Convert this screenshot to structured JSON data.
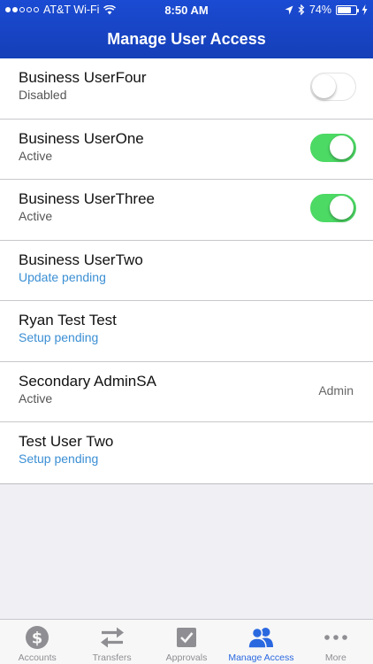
{
  "status_bar": {
    "carrier": "AT&T Wi-Fi",
    "time": "8:50 AM",
    "battery": "74%",
    "battery_level": 0.74
  },
  "nav": {
    "title": "Manage User Access"
  },
  "users": [
    {
      "name": "Business UserFour",
      "status": "Disabled",
      "status_color": "#555555",
      "toggle": "off",
      "tag": ""
    },
    {
      "name": "Business UserOne",
      "status": "Active",
      "status_color": "#555555",
      "toggle": "on",
      "tag": ""
    },
    {
      "name": "Business UserThree",
      "status": "Active",
      "status_color": "#555555",
      "toggle": "on",
      "tag": ""
    },
    {
      "name": "Business UserTwo",
      "status": "Update pending",
      "status_color": "#3b8fd4",
      "toggle": "none",
      "tag": ""
    },
    {
      "name": "Ryan Test Test",
      "status": "Setup pending",
      "status_color": "#3b8fd4",
      "toggle": "none",
      "tag": ""
    },
    {
      "name": "Secondary AdminSA",
      "status": "Active",
      "status_color": "#555555",
      "toggle": "none",
      "tag": "Admin"
    },
    {
      "name": "Test User Two",
      "status": "Setup pending",
      "status_color": "#3b8fd4",
      "toggle": "none",
      "tag": ""
    }
  ],
  "tabs": [
    {
      "label": "Accounts",
      "icon": "dollar-icon",
      "active": false
    },
    {
      "label": "Transfers",
      "icon": "transfer-arrows-icon",
      "active": false
    },
    {
      "label": "Approvals",
      "icon": "checkbox-icon",
      "active": false
    },
    {
      "label": "Manage Access",
      "icon": "users-icon",
      "active": true
    },
    {
      "label": "More",
      "icon": "more-dots-icon",
      "active": false
    }
  ],
  "colors": {
    "header": "#1b4bd3",
    "toggle_on": "#4cd964",
    "tab_active": "#2a68e0",
    "tab_inactive": "#8e8e93",
    "pending": "#3b8fd4"
  }
}
